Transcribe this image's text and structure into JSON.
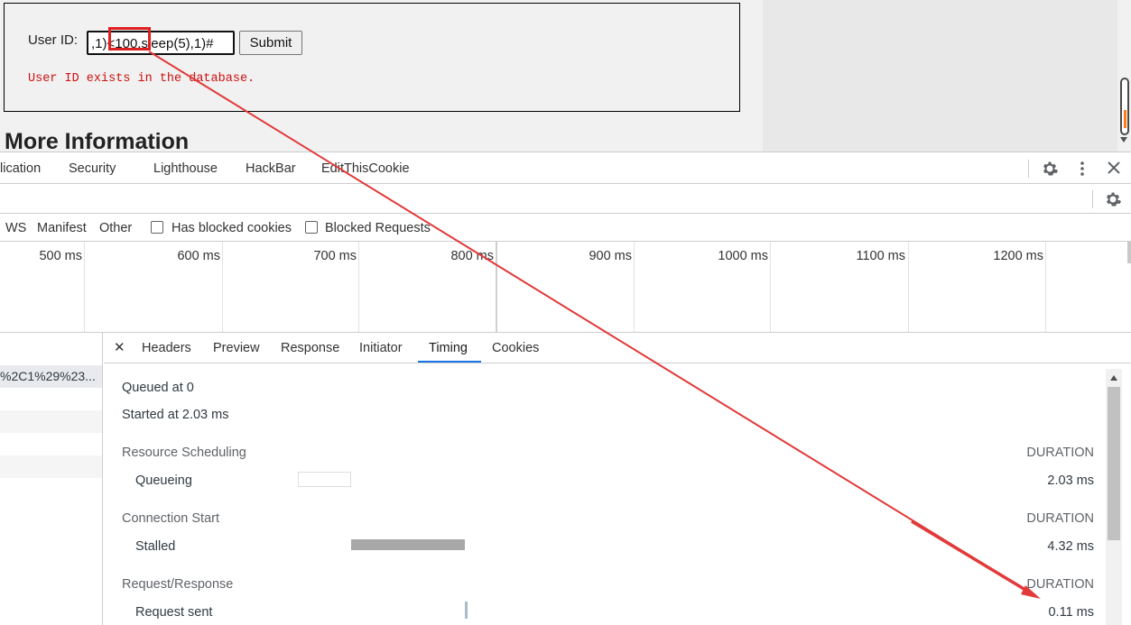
{
  "page": {
    "user_id_label": "User ID:",
    "input_value": ",1)<100,sleep(5),1)#",
    "submit_label": "Submit",
    "result_message": "User ID exists in the database.",
    "more_info_heading": "More Information"
  },
  "devtools": {
    "panel_tabs": [
      "lication",
      "Security",
      "Lighthouse",
      "HackBar",
      "EditThisCookie"
    ],
    "icons": [
      "gear-icon",
      "kebab-menu-icon",
      "close-icon",
      "network-settings-icon"
    ],
    "filters": {
      "types": [
        "WS",
        "Manifest",
        "Other"
      ],
      "has_blocked_cookies": "Has blocked cookies",
      "blocked_requests": "Blocked Requests"
    },
    "overview_ticks": [
      "500 ms",
      "600 ms",
      "700 ms",
      "800 ms",
      "900 ms",
      "1000 ms",
      "1100 ms",
      "1200 ms"
    ],
    "request_list": {
      "rows": [
        "%2C1%29%23..."
      ]
    },
    "detail_tabs": [
      "Headers",
      "Preview",
      "Response",
      "Initiator",
      "Timing",
      "Cookies"
    ],
    "active_detail_tab": "Timing",
    "timing": {
      "queued_at": "Queued at 0",
      "started_at": "Started at 2.03 ms",
      "duration_label": "DURATION",
      "sections": [
        {
          "title": "Resource Scheduling",
          "phase": "Queueing",
          "value": "2.03 ms"
        },
        {
          "title": "Connection Start",
          "phase": "Stalled",
          "value": "4.32 ms"
        },
        {
          "title": "Request/Response",
          "phase": "Request sent",
          "value": "0.11 ms"
        }
      ]
    },
    "colors": {
      "active_tab_underline": "#1a73e8",
      "annotation_red": "#e23a3a",
      "error_text": "#cc1111",
      "stalled_bar": "#a8a8a8"
    }
  }
}
